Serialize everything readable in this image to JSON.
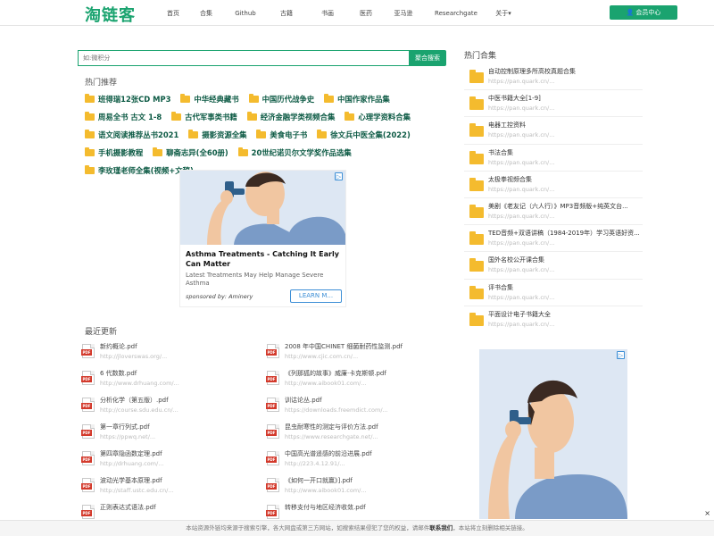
{
  "header": {
    "logo": "淘链客",
    "nav": [
      "首页",
      "合集",
      "Github",
      "古籍",
      "书画",
      "医药",
      "亚马逊",
      "Researchgate",
      "关于▾"
    ],
    "member_label": "会员中心"
  },
  "search": {
    "placeholder": "如:微积分",
    "button": "聚合搜索"
  },
  "hot": {
    "title": "热门推荐",
    "tags": [
      "班得瑞12张CD MP3",
      "中华经典藏书",
      "中国历代战争史",
      "中国作家作品集",
      "周易全书 古文 1-8",
      "古代军事类书籍",
      "经济金融学类视频合集",
      "心理学资料合集",
      "语文阅读推荐丛书2021",
      "摄影资源全集",
      "美食电子书",
      "徐文兵中医全集(2022)",
      "手机摄影教程",
      "聊斋志异(全60册)",
      "20世纪诺贝尔文学奖作品选集",
      "李玫瑾老师全集(视频+文稿)"
    ]
  },
  "ad1": {
    "title": "Asthma Treatments - Catching It Early Can Matter",
    "desc": "Latest Treatments May Help Manage Severe Asthma",
    "sponsor": "sponsored by: Aminery",
    "button": "LEARN M..."
  },
  "recent": {
    "title": "最近更新",
    "rows": [
      [
        {
          "name": "新约概论.pdf",
          "url": "http://jloverswas.org/..."
        },
        {
          "name": "2008 年中国CHINET 细菌耐药性监测.pdf",
          "url": "http://www.cjic.com.cn/..."
        }
      ],
      [
        {
          "name": "6 代数数.pdf",
          "url": "http://www.drhuang.com/..."
        },
        {
          "name": "《列那狐的故事》威廉·卡克斯顿.pdf",
          "url": "http://www.aibook01.com/..."
        }
      ],
      [
        {
          "name": "分析化学（第五版）.pdf",
          "url": "http://course.sdu.edu.cn/..."
        },
        {
          "name": "训诂论丛.pdf",
          "url": "https://downloads.freemdict.com/..."
        }
      ],
      [
        {
          "name": "第一章行列式.pdf",
          "url": "https://ppwq.net/..."
        },
        {
          "name": "昆虫耐寒性的测定与评价方法.pdf",
          "url": "https://www.researchgate.net/..."
        }
      ],
      [
        {
          "name": "第四章隐函数定理.pdf",
          "url": "http://drhuang.com/..."
        },
        {
          "name": "中国高光谱遥感的前沿进展.pdf",
          "url": "http://223.4.12.91/..."
        }
      ],
      [
        {
          "name": "波动光学基本原理.pdf",
          "url": "http://staff.ustc.edu.cn/..."
        },
        {
          "name": "《如何一开口就赢》].pdf",
          "url": "http://www.aibook01.com/..."
        }
      ],
      [
        {
          "name": "正则表达式语法.pdf",
          "url": ""
        },
        {
          "name": "转移支付与地区经济收敛.pdf",
          "url": ""
        }
      ]
    ]
  },
  "right": {
    "title": "热门合集",
    "items": [
      {
        "name": "自动控制原理多所高校真题合集",
        "url": "https://pan.quark.cn/..."
      },
      {
        "name": "中医书籍大全[1-9]",
        "url": "https://pan.quark.cn/..."
      },
      {
        "name": "电器工控资料",
        "url": "https://pan.quark.cn/..."
      },
      {
        "name": "书法合集",
        "url": "https://pan.quark.cn/..."
      },
      {
        "name": "太极拳视频合集",
        "url": "https://pan.quark.cn/..."
      },
      {
        "name": "美剧《老友记（六人行）》MP3音频版+纯英文台...",
        "url": "https://pan.quark.cn/..."
      },
      {
        "name": "TED音频+双语讲稿（1984-2019年）学习英语好资...",
        "url": "https://pan.quark.cn/..."
      },
      {
        "name": "国外名校公开课合集",
        "url": "https://pan.quark.cn/..."
      },
      {
        "name": "评书合集",
        "url": "https://pan.quark.cn/..."
      },
      {
        "name": "平面设计电子书籍大全",
        "url": "https://pan.quark.cn/..."
      }
    ]
  },
  "notice": {
    "text_before": "本站资源外链均来源于搜索引擎，各大网盘或第三方网站，如搜索结果侵犯了您的权益，请邮件",
    "link": "联系我们",
    "text_after": "，本站将立刻删除相关链接。",
    "close": "×"
  },
  "colors": {
    "brand": "#1aa36f",
    "folder": "#f4bb2e",
    "tag_text": "#0c5a44"
  }
}
